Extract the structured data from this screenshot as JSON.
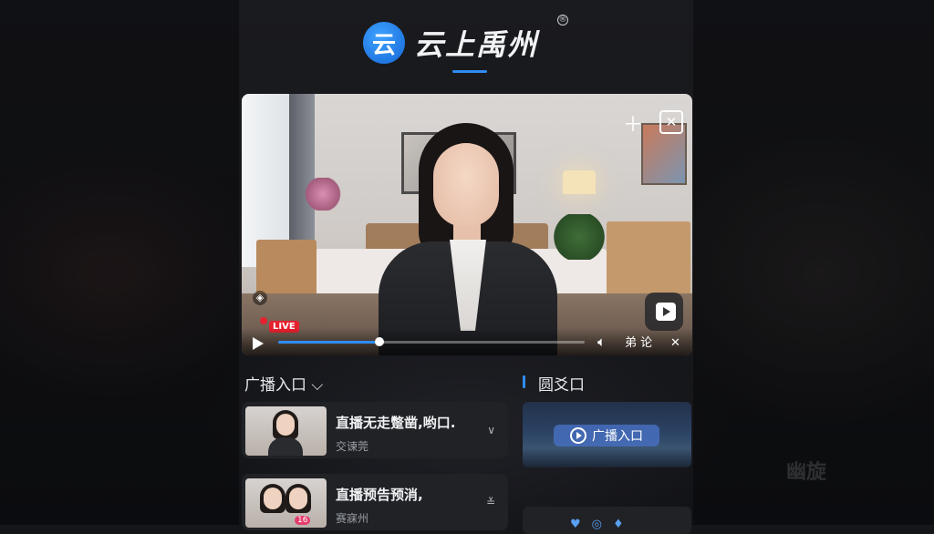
{
  "header": {
    "logo_char": "云",
    "brand_name": "云上禹州",
    "reg_mark": "®"
  },
  "video": {
    "live_label": "LIVE",
    "controls_text": "弟 论",
    "progress": 0.33
  },
  "sections": {
    "left_title": "广播入口 ⌵",
    "right_title": "圆爻口"
  },
  "list": [
    {
      "title": "直播无走蹩凿,哟口.",
      "sub": "交谏莞",
      "badge": ""
    },
    {
      "title": "直播预告预消,",
      "sub": "赛寐州",
      "badge": "16"
    }
  ],
  "promo": {
    "button_label": "广播入口"
  },
  "background": {
    "ghost_text": "幽旋"
  },
  "colors": {
    "accent": "#2f8cf0",
    "live": "#e6212e"
  }
}
